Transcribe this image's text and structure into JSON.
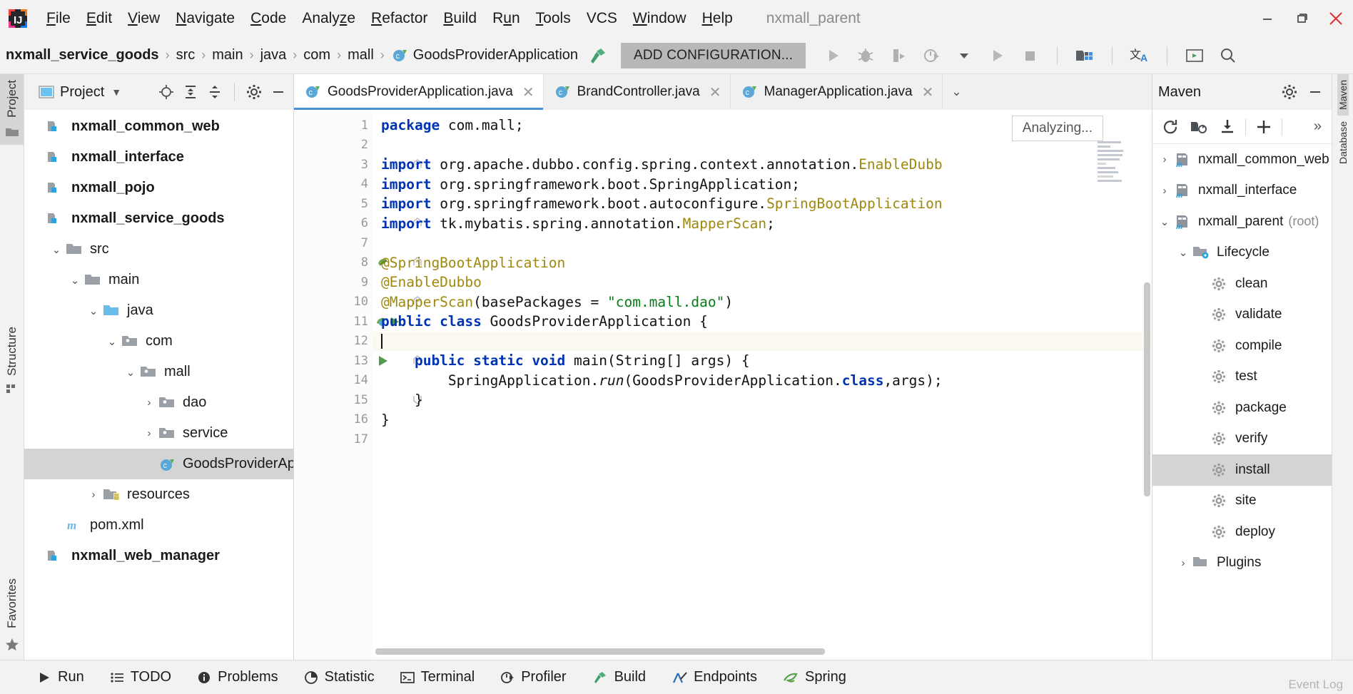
{
  "window": {
    "project_title": "nxmall_parent",
    "minimize": "–",
    "maximize": "□",
    "close": "✕"
  },
  "menubar": {
    "logo": "intellij-idea-logo",
    "items": [
      {
        "label": "File",
        "mnemonic": "F"
      },
      {
        "label": "Edit",
        "mnemonic": "E"
      },
      {
        "label": "View",
        "mnemonic": "V"
      },
      {
        "label": "Navigate",
        "mnemonic": "N"
      },
      {
        "label": "Code",
        "mnemonic": "C"
      },
      {
        "label": "Analyze",
        "mnemonic": "z"
      },
      {
        "label": "Refactor",
        "mnemonic": "R"
      },
      {
        "label": "Build",
        "mnemonic": "B"
      },
      {
        "label": "Run",
        "mnemonic": "u"
      },
      {
        "label": "Tools",
        "mnemonic": "T"
      },
      {
        "label": "VCS",
        "mnemonic": ""
      },
      {
        "label": "Window",
        "mnemonic": "W"
      },
      {
        "label": "Help",
        "mnemonic": "H"
      }
    ]
  },
  "navbar": {
    "breadcrumbs": [
      {
        "label": "nxmall_service_goods",
        "bold": true,
        "icon": ""
      },
      {
        "label": "src",
        "bold": false,
        "icon": ""
      },
      {
        "label": "main",
        "bold": false,
        "icon": ""
      },
      {
        "label": "java",
        "bold": false,
        "icon": ""
      },
      {
        "label": "com",
        "bold": false,
        "icon": ""
      },
      {
        "label": "mall",
        "bold": false,
        "icon": ""
      },
      {
        "label": "GoodsProviderApplication",
        "bold": false,
        "icon": "java-class-icon"
      }
    ],
    "separator": "›",
    "build_icon": "hammer-icon",
    "add_configuration": "ADD CONFIGURATION...",
    "toolbar_icons": [
      "run-icon",
      "debug-icon",
      "run-coverage-icon",
      "profiler-icon",
      "dropdown-icon",
      "run2-icon",
      "stop-icon",
      "project-structure-icon",
      "translate-icon",
      "present-mode-icon",
      "search-icon"
    ]
  },
  "left_rail": {
    "top_label": "Project",
    "mid_label": "Structure",
    "bottom_label": "Favorites"
  },
  "project_panel": {
    "title": "Project",
    "title_icon": "project-view-icon",
    "dropdown": "▾",
    "header_icons": [
      "locate-icon",
      "expand-all-icon",
      "collapse-all-icon",
      "gear-icon",
      "hide-icon"
    ],
    "tree": [
      {
        "label": "nxmall_common_web",
        "depth": 0,
        "arrow": "",
        "icon": "module-icon",
        "bold": true,
        "selected": false
      },
      {
        "label": "nxmall_interface",
        "depth": 0,
        "arrow": "",
        "icon": "module-icon",
        "bold": true,
        "selected": false
      },
      {
        "label": "nxmall_pojo",
        "depth": 0,
        "arrow": "",
        "icon": "module-icon",
        "bold": true,
        "selected": false
      },
      {
        "label": "nxmall_service_goods",
        "depth": 0,
        "arrow": "",
        "icon": "module-icon",
        "bold": true,
        "selected": false
      },
      {
        "label": "src",
        "depth": 1,
        "arrow": "⌄",
        "icon": "folder-icon",
        "bold": false,
        "selected": false
      },
      {
        "label": "main",
        "depth": 2,
        "arrow": "⌄",
        "icon": "folder-icon",
        "bold": false,
        "selected": false
      },
      {
        "label": "java",
        "depth": 3,
        "arrow": "⌄",
        "icon": "source-folder-icon",
        "bold": false,
        "selected": false
      },
      {
        "label": "com",
        "depth": 4,
        "arrow": "⌄",
        "icon": "package-icon",
        "bold": false,
        "selected": false
      },
      {
        "label": "mall",
        "depth": 5,
        "arrow": "⌄",
        "icon": "package-icon",
        "bold": false,
        "selected": false
      },
      {
        "label": "dao",
        "depth": 6,
        "arrow": "›",
        "icon": "package-icon",
        "bold": false,
        "selected": false
      },
      {
        "label": "service",
        "depth": 6,
        "arrow": "›",
        "icon": "package-icon",
        "bold": false,
        "selected": false
      },
      {
        "label": "GoodsProviderApplicatio",
        "depth": 6,
        "arrow": "",
        "icon": "java-class-icon",
        "bold": false,
        "selected": true
      },
      {
        "label": "resources",
        "depth": 3,
        "arrow": "›",
        "icon": "resources-folder-icon",
        "bold": false,
        "selected": false
      },
      {
        "label": "pom.xml",
        "depth": 1,
        "arrow": "",
        "icon": "maven-icon",
        "bold": false,
        "selected": false
      },
      {
        "label": "nxmall_web_manager",
        "depth": 0,
        "arrow": "",
        "icon": "module-icon",
        "bold": true,
        "selected": false
      }
    ]
  },
  "editor": {
    "tabs": [
      {
        "label": "GoodsProviderApplication.java",
        "icon": "java-class-icon",
        "active": true,
        "close": "✕"
      },
      {
        "label": "BrandController.java",
        "icon": "java-class-icon",
        "active": false,
        "close": "✕"
      },
      {
        "label": "ManagerApplication.java",
        "icon": "java-class-icon",
        "active": false,
        "close": "✕"
      }
    ],
    "tab_chevron": "⌄",
    "analyzing_tooltip": "Analyzing...",
    "line_numbers": [
      "1",
      "2",
      "3",
      "4",
      "5",
      "6",
      "7",
      "8",
      "9",
      "10",
      "11",
      "12",
      "13",
      "14",
      "15",
      "16",
      "17"
    ],
    "gutter_marks": {
      "8": "bean-icon",
      "11": "spring-bean-run-icon",
      "13": "run-method-icon"
    },
    "code_lines": [
      {
        "n": 1,
        "tokens": [
          {
            "t": "package ",
            "c": "kw"
          },
          {
            "t": "com.mall;",
            "c": ""
          }
        ]
      },
      {
        "n": 2,
        "tokens": []
      },
      {
        "n": 3,
        "tokens": [
          {
            "t": "import ",
            "c": "kw"
          },
          {
            "t": "org.apache.dubbo.config.spring.context.annotation.",
            "c": ""
          },
          {
            "t": "EnableDubb",
            "c": "anno"
          }
        ]
      },
      {
        "n": 4,
        "tokens": [
          {
            "t": "import ",
            "c": "kw"
          },
          {
            "t": "org.springframework.boot.SpringApplication;",
            "c": ""
          }
        ]
      },
      {
        "n": 5,
        "tokens": [
          {
            "t": "import ",
            "c": "kw"
          },
          {
            "t": "org.springframework.boot.autoconfigure.",
            "c": ""
          },
          {
            "t": "SpringBootApplication",
            "c": "anno"
          }
        ]
      },
      {
        "n": 6,
        "tokens": [
          {
            "t": "import ",
            "c": "kw"
          },
          {
            "t": "tk.mybatis.spring.annotation.",
            "c": ""
          },
          {
            "t": "MapperScan",
            "c": "anno"
          },
          {
            "t": ";",
            "c": ""
          }
        ]
      },
      {
        "n": 7,
        "tokens": []
      },
      {
        "n": 8,
        "tokens": [
          {
            "t": "@SpringBootApplication",
            "c": "anno"
          }
        ]
      },
      {
        "n": 9,
        "tokens": [
          {
            "t": "@EnableDubbo",
            "c": "anno"
          }
        ]
      },
      {
        "n": 10,
        "tokens": [
          {
            "t": "@MapperScan",
            "c": "anno"
          },
          {
            "t": "(basePackages = ",
            "c": ""
          },
          {
            "t": "\"com.mall.dao\"",
            "c": "str"
          },
          {
            "t": ")",
            "c": ""
          }
        ]
      },
      {
        "n": 11,
        "tokens": [
          {
            "t": "public class ",
            "c": "kw"
          },
          {
            "t": "GoodsProviderApplication {",
            "c": ""
          }
        ]
      },
      {
        "n": 12,
        "tokens": []
      },
      {
        "n": 13,
        "tokens": [
          {
            "t": "    public static void ",
            "c": "kw"
          },
          {
            "t": "main(String[] args) {",
            "c": ""
          }
        ]
      },
      {
        "n": 14,
        "tokens": [
          {
            "t": "        SpringApplication.",
            "c": ""
          },
          {
            "t": "run",
            "c": "itl"
          },
          {
            "t": "(GoodsProviderApplication.",
            "c": ""
          },
          {
            "t": "class",
            "c": "kw"
          },
          {
            "t": ",args);",
            "c": ""
          }
        ]
      },
      {
        "n": 15,
        "tokens": [
          {
            "t": "    }",
            "c": ""
          }
        ]
      },
      {
        "n": 16,
        "tokens": [
          {
            "t": "}",
            "c": ""
          }
        ]
      },
      {
        "n": 17,
        "tokens": []
      }
    ]
  },
  "maven_panel": {
    "title": "Maven",
    "header_icons": [
      "gear-icon",
      "hide-icon"
    ],
    "toolbar_icons": [
      "reimport-icon",
      "generate-sources-icon",
      "download-sources-icon",
      "add-icon",
      "more-icon"
    ],
    "more_label": "»",
    "tree": [
      {
        "label": "nxmall_common_web",
        "depth": 0,
        "arrow": "›",
        "icon": "maven-module-icon",
        "suffix": "",
        "selected": false
      },
      {
        "label": "nxmall_interface",
        "depth": 0,
        "arrow": "›",
        "icon": "maven-module-icon",
        "suffix": "",
        "selected": false
      },
      {
        "label": "nxmall_parent",
        "depth": 0,
        "arrow": "⌄",
        "icon": "maven-module-icon",
        "suffix": "(root)",
        "selected": false
      },
      {
        "label": "Lifecycle",
        "depth": 1,
        "arrow": "⌄",
        "icon": "lifecycle-folder-icon",
        "suffix": "",
        "selected": false
      },
      {
        "label": "clean",
        "depth": 2,
        "arrow": "",
        "icon": "maven-goal-icon",
        "suffix": "",
        "selected": false
      },
      {
        "label": "validate",
        "depth": 2,
        "arrow": "",
        "icon": "maven-goal-icon",
        "suffix": "",
        "selected": false
      },
      {
        "label": "compile",
        "depth": 2,
        "arrow": "",
        "icon": "maven-goal-icon",
        "suffix": "",
        "selected": false
      },
      {
        "label": "test",
        "depth": 2,
        "arrow": "",
        "icon": "maven-goal-icon",
        "suffix": "",
        "selected": false
      },
      {
        "label": "package",
        "depth": 2,
        "arrow": "",
        "icon": "maven-goal-icon",
        "suffix": "",
        "selected": false
      },
      {
        "label": "verify",
        "depth": 2,
        "arrow": "",
        "icon": "maven-goal-icon",
        "suffix": "",
        "selected": false
      },
      {
        "label": "install",
        "depth": 2,
        "arrow": "",
        "icon": "maven-goal-icon",
        "suffix": "",
        "selected": true
      },
      {
        "label": "site",
        "depth": 2,
        "arrow": "",
        "icon": "maven-goal-icon",
        "suffix": "",
        "selected": false
      },
      {
        "label": "deploy",
        "depth": 2,
        "arrow": "",
        "icon": "maven-goal-icon",
        "suffix": "",
        "selected": false
      },
      {
        "label": "Plugins",
        "depth": 1,
        "arrow": "›",
        "icon": "plugins-folder-icon",
        "suffix": "",
        "selected": false
      }
    ]
  },
  "statusbar": {
    "items": [
      {
        "label": "Run",
        "icon": "run-icon"
      },
      {
        "label": "TODO",
        "icon": "todo-icon"
      },
      {
        "label": "Problems",
        "icon": "problems-icon"
      },
      {
        "label": "Statistic",
        "icon": "statistic-icon"
      },
      {
        "label": "Terminal",
        "icon": "terminal-icon"
      },
      {
        "label": "Profiler",
        "icon": "profiler-icon"
      },
      {
        "label": "Build",
        "icon": "build-icon"
      },
      {
        "label": "Endpoints",
        "icon": "endpoints-icon"
      },
      {
        "label": "Spring",
        "icon": "spring-icon"
      }
    ],
    "right_label": "Event Log"
  },
  "colors": {
    "accent": "#4a90d9",
    "selection": "#d4d4d4",
    "keyword": "#0033b3",
    "annotation": "#9e880d",
    "string": "#067d17",
    "toolbar_bg": "#f2f2f2"
  }
}
